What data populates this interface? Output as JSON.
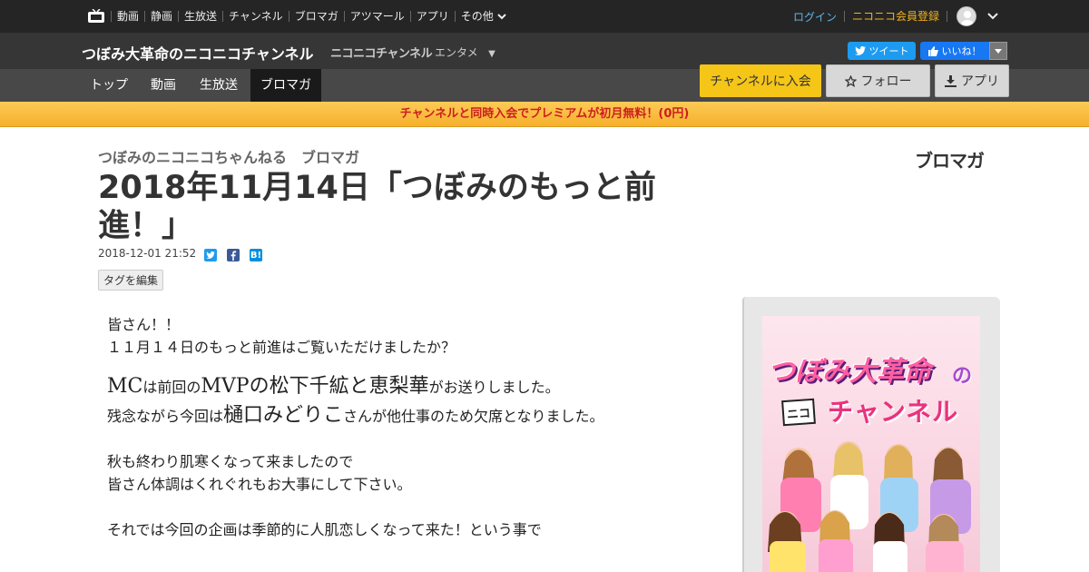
{
  "topbar": {
    "menu": [
      "動画",
      "静画",
      "生放送",
      "チャンネル",
      "ブロマガ",
      "アツマール",
      "アプリ"
    ],
    "more_label": "その他",
    "login_label": "ログイン",
    "register_label": "ニコニコ会員登録"
  },
  "channel": {
    "name": "つぼみ大革命のニコニコチャンネル",
    "brand": "ニコニコチャンネル",
    "genre": "エンタメ",
    "genre_arrow": "▼",
    "tweet_label": "ツイート",
    "like_label": "いいね！",
    "tabs": [
      "トップ",
      "動画",
      "生放送",
      "ブロマガ"
    ],
    "active_tab": "ブロマガ",
    "join_label": "チャンネルに入会",
    "follow_label": "フォロー",
    "app_label": "アプリ"
  },
  "promo": {
    "text": "チャンネルと同時入会でプレミアムが初月無料！(0円)"
  },
  "article": {
    "breadcrumb_channel": "つぼみのニコニコちゃんねる",
    "breadcrumb_section": "ブロマガ",
    "blomaga_logo": "ブロマガ",
    "title": "2018年11月14日「つぼみのもっと前進！」",
    "date": "2018-12-01 21:52",
    "share_hatena": "B!",
    "tag_edit_label": "タグを編集",
    "body": {
      "l1": "皆さん！！",
      "l2": "１１月１４日のもっと前進はご覧いただけましたか？",
      "l3a": "MC",
      "l3b": "は前回の",
      "l3c": "MVPの松下千絋と恵梨華",
      "l3d": "がお送りしました。",
      "l4a": "残念ながら今回は",
      "l4b": "樋口みどりこ",
      "l4c": "さんが他仕事のため欠席となりました。",
      "l5": "秋も終わり肌寒くなって来ましたので",
      "l6": "皆さん体調はくれぐれもお大事にして下さい。",
      "l7": "それでは今回の企画は季節的に人肌恋しくなって来た！という事で"
    }
  },
  "sidebar": {
    "thumb_title": "つぼみ大革命",
    "thumb_no": "の",
    "thumb_nico": "ニコ",
    "thumb_channel": "チャンネル"
  },
  "colors": {
    "topbar_bg": "#252525",
    "channel_header_bg": "#363636",
    "channel_nav_bg": "#484848",
    "join_button": "#f5c518",
    "promo_text": "#cc1f1f",
    "login_link": "#5fb6e6",
    "register_link": "#f4b31a"
  }
}
